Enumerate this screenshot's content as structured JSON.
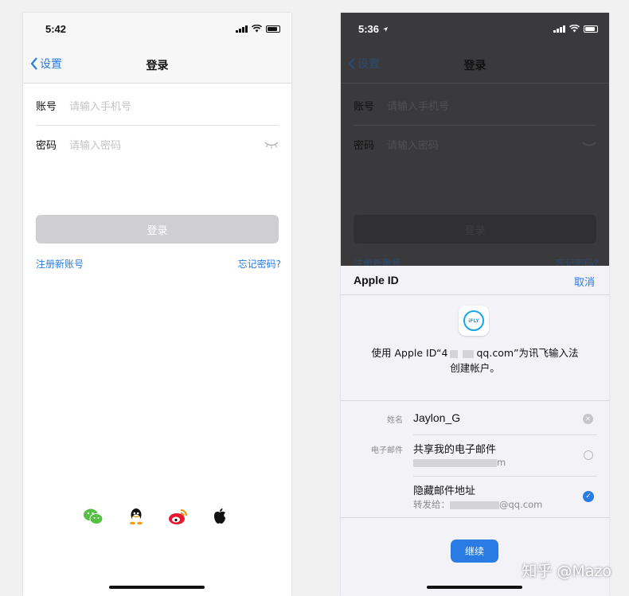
{
  "left": {
    "status": {
      "time": "5:42"
    },
    "nav": {
      "back_label": "设置",
      "title": "登录"
    },
    "account": {
      "label": "账号",
      "placeholder": "请输入手机号"
    },
    "password": {
      "label": "密码",
      "placeholder": "请输入密码"
    },
    "login_button": "登录",
    "register_link": "注册新账号",
    "forgot_link": "忘记密码?",
    "social_icons": [
      "wechat-icon",
      "qq-icon",
      "weibo-icon",
      "apple-icon"
    ]
  },
  "right": {
    "status": {
      "time": "5:36"
    },
    "nav": {
      "back_label": "设置",
      "title": "登录"
    },
    "account": {
      "label": "账号",
      "placeholder": "请输入手机号"
    },
    "password": {
      "label": "密码",
      "placeholder": "请输入密码"
    },
    "login_button": "登录",
    "register_link": "注册新账号",
    "forgot_link": "忘记密码?",
    "sheet": {
      "title": "Apple ID",
      "cancel": "取消",
      "app_icon_text": "iFLY",
      "desc_prefix": "使用 Apple ID“4",
      "desc_email_tail": "qq.com”为讯飞输入法",
      "desc_line2": "创建帐户。",
      "name_label": "姓名",
      "name_value": "Jaylon_G",
      "email_label": "电子邮件",
      "share_email": "共享我的电子邮件",
      "share_email_masked_tail": "m",
      "hide_email": "隐藏邮件地址",
      "forward_to": "转发给：",
      "forward_tail": "@qq.com",
      "continue": "继续"
    }
  },
  "watermark": "知乎 @Mazo",
  "colors": {
    "accent": "#2a7be4",
    "link": "#2a7be4",
    "dark_bg": "#1c1c1e",
    "sheet_bg": "#f2f2f7"
  }
}
